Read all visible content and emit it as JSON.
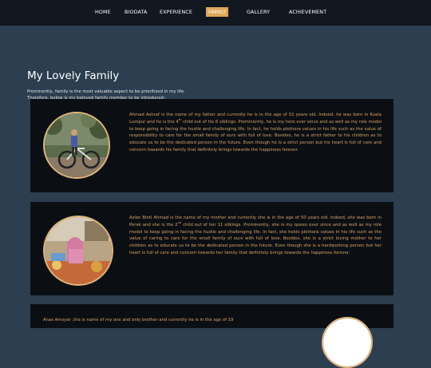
{
  "nav": {
    "items": [
      {
        "label": "HOME"
      },
      {
        "label": "BIODATA"
      },
      {
        "label": "EXPERIENCE"
      },
      {
        "label": "FAMILY"
      },
      {
        "label": "GALLERY"
      },
      {
        "label": "ACHIEVEMENT"
      }
    ],
    "active": "FAMILY"
  },
  "page": {
    "title": "My Lovely Family",
    "intro_line1": "Prominently, family is the most valuable aspect to be prioritised in my life.",
    "intro_line2": "Therefore, below is my beloved family member to be introduced:-"
  },
  "members": [
    {
      "text_before": "Ahmad Ashraf is the name of my father and currently he is in the age of 51 years old. Indeed, he was born in Kuala Lumpur and he is the 4",
      "ordinal_sup": "th",
      "text_after": " child out of his 6 siblings. Prominently, he is my hero ever since and as well as my role model to keep going in facing the hustle and challenging life. In fact, he holds plethora values in his life such as the value of responsibility to care for the small family of ours with full of love. Besides, he is a strict father to his children as to educate us to be the dedicated person in the future. Even though he is a strict person but his heart is full of care and concern towards his family that definitely brings towards the happiness forever."
    },
    {
      "text_before": "Azian Binti Ahmad is the name of my mother and currently she is in the age of 50 years old. Indeed, she was born in Perak and she is the 2",
      "ordinal_sup": "nd",
      "text_after": " child out of her 11 siblings. Prominently, she is my queen ever since and as well as my role model to keep going in facing the hustle and challenging life. In fact, she holds plethora values in his life such as the value of caring to care for the small family of ours with full of love. Besides, she is a strict loving mother to her children as to educate us to be the dedicated person in the future. Even though she is a hardworking person but her heart is full of care and concern towards her family that definitely brings towards the happiness forever."
    },
    {
      "text_before": "Anas Amsyar ,the is name of my one and only brother and currently he is in the age of 19",
      "ordinal_sup": "",
      "text_after": ""
    }
  ],
  "colors": {
    "background": "#2c3e50",
    "navbar": "#111820",
    "accent": "#e0a65b",
    "card": "#0b0f14",
    "card_text": "#d9a463"
  }
}
